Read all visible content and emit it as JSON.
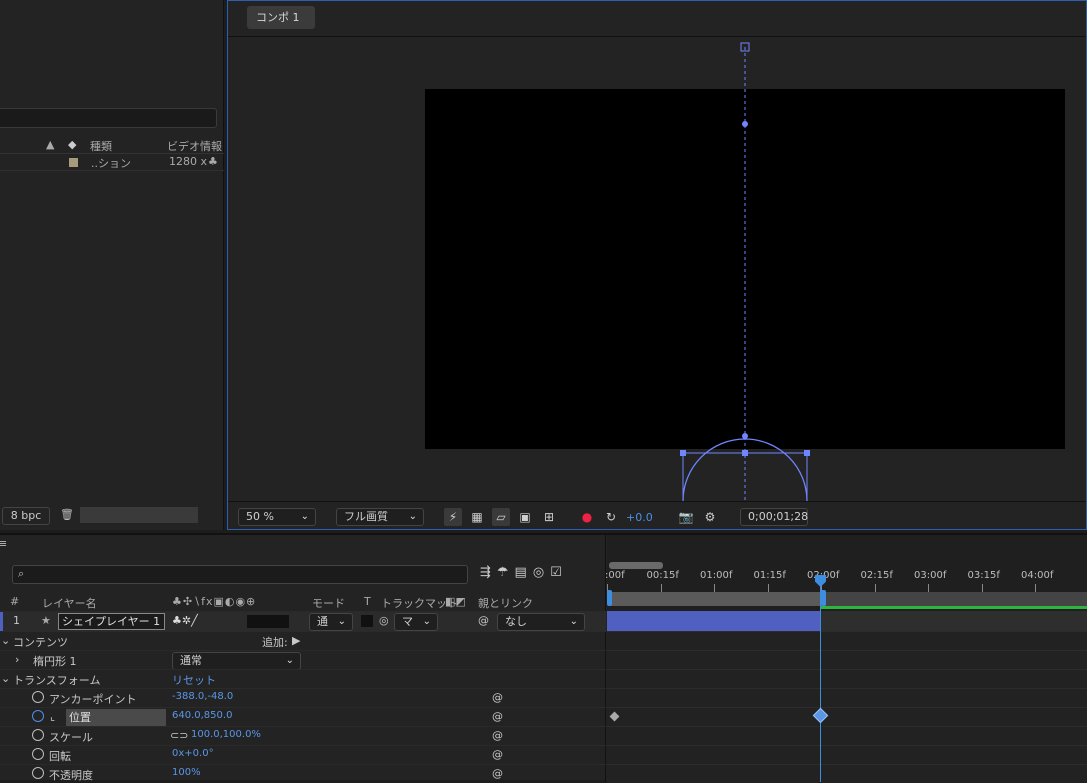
{
  "project": {
    "columns": {
      "type": "種類",
      "video_info": "ビデオ情報"
    },
    "item": {
      "type": "..ション",
      "video_info": "1280 x"
    },
    "bit_depth": "8 bpc"
  },
  "composition": {
    "tab_label": "コンポ 1",
    "zoom": "50 %",
    "resolution": "フル画質",
    "exposure": "+0.0",
    "timecode": "0;00;01;28"
  },
  "timeline": {
    "columns": {
      "num": "#",
      "layer_name": "レイヤー名",
      "mode": "モード",
      "t": "T",
      "track_matte": "トラックマット",
      "parent": "親とリンク"
    },
    "layer": {
      "num": "1",
      "name": "シェイプレイヤー 1",
      "mode": "通",
      "matte": "マ",
      "parent": "なし"
    },
    "rows": {
      "contents": "コンテンツ",
      "add": "追加:",
      "ellipse": "楕円形 1",
      "blend_mode": "通常",
      "transform": "トランスフォーム",
      "reset": "リセット",
      "anchor": "アンカーポイント",
      "anchor_val": "-388.0,-48.0",
      "position": "位置",
      "position_val": "640.0,850.0",
      "scale": "スケール",
      "scale_val": "100.0,100.0%",
      "rotation": "回転",
      "rotation_val": "0x+0.0°",
      "opacity": "不透明度",
      "opacity_val": "100%"
    },
    "ruler": [
      ":00f",
      "00:15f",
      "01:00f",
      "01:15f",
      "02:00f",
      "02:15f",
      "03:00f",
      "03:15f",
      "04:00f"
    ]
  },
  "colors": {
    "accent": "#2d8ceb",
    "layer_bar": "#5060c0",
    "work_area": "#3d8de0",
    "guide": "#6f86ff",
    "keyframe": "#5a96e6"
  }
}
